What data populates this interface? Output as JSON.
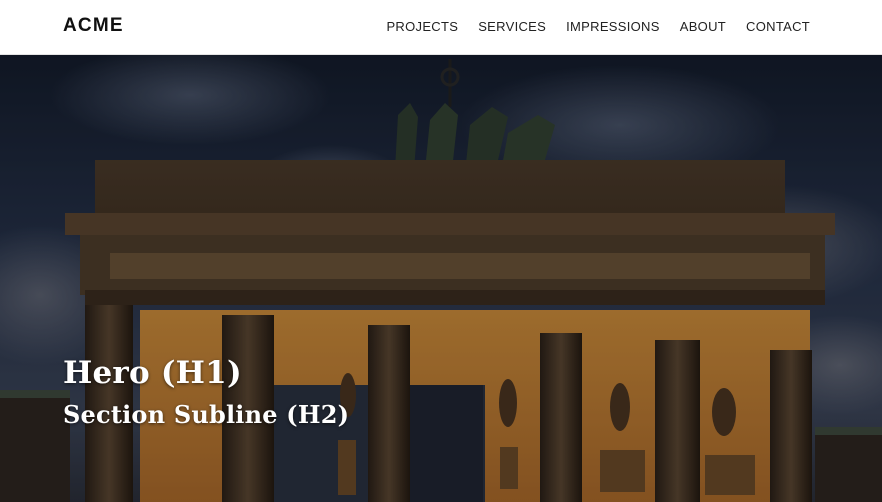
{
  "header": {
    "logo": "ACME",
    "nav": [
      {
        "label": "PROJECTS"
      },
      {
        "label": "SERVICES"
      },
      {
        "label": "IMPRESSIONS"
      },
      {
        "label": "ABOUT"
      },
      {
        "label": "CONTACT"
      }
    ]
  },
  "hero": {
    "title": "Hero (H1)",
    "subline": "Section Subline (H2)",
    "image": "brandenburg-gate-photo"
  }
}
